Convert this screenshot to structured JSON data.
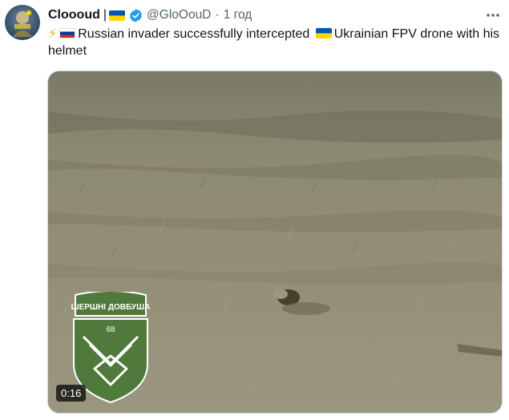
{
  "tweet": {
    "author_name": "Cloooud",
    "name_separator": "|",
    "handle": "@GloOouD",
    "separator_dot": "·",
    "time": "1 год",
    "text_parts": {
      "bolt": "⚡",
      "part1": "Russian invader successfully intercepted ",
      "part2": "Ukrainian FPV drone with his helmet"
    }
  },
  "media": {
    "duration": "0:16",
    "badge_title": "ШЕРШНІ ДОВБУША",
    "badge_number": "68"
  },
  "colors": {
    "verified_blue": "#1d9bf0",
    "muted_text": "#536471",
    "badge_green": "#4f7a3c"
  },
  "icons": {
    "verified": "verified-badge-icon",
    "more": "more-options-icon",
    "flag_ua": "ukraine-flag-icon",
    "flag_ru": "russia-flag-icon"
  }
}
